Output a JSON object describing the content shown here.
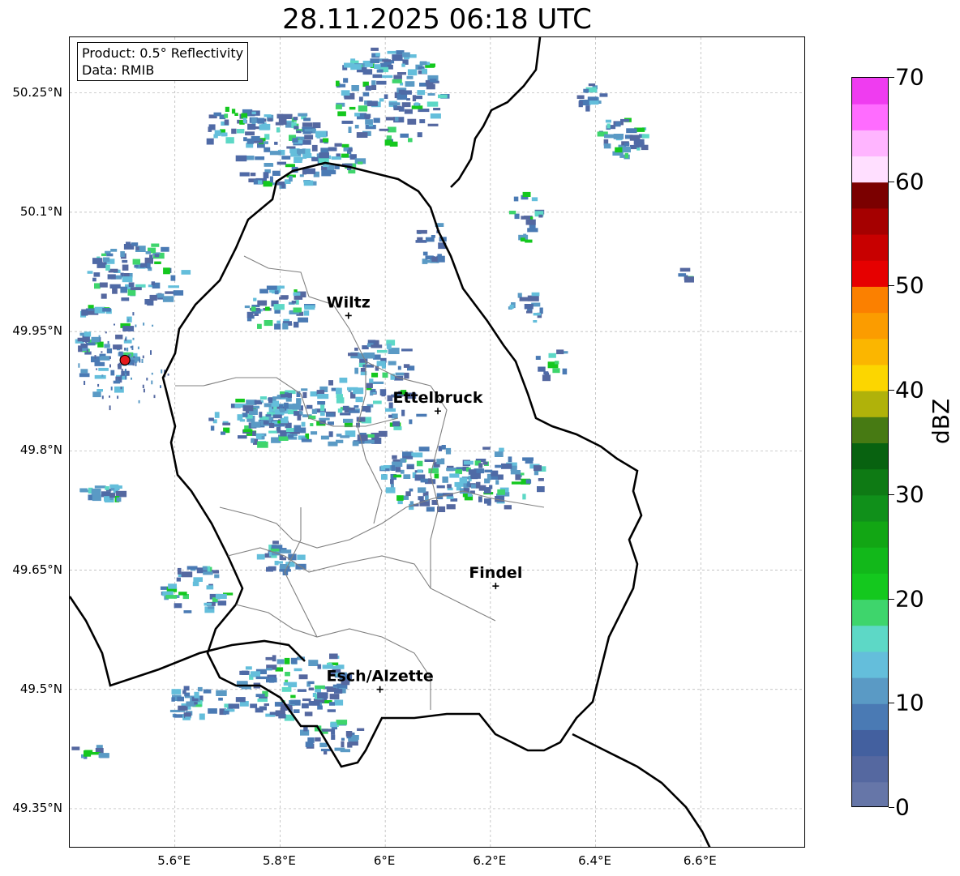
{
  "title": "28.11.2025 06:18 UTC",
  "info_box": {
    "product": "Product: 0.5° Reflectivity",
    "data": "Data: RMIB"
  },
  "map_extent": {
    "lon": [
      5.4,
      6.8
    ],
    "lat": [
      49.3,
      50.32
    ]
  },
  "lat_ticks": [
    {
      "label": "50.25°N",
      "value": 50.25
    },
    {
      "label": "50.1°N",
      "value": 50.1
    },
    {
      "label": "49.95°N",
      "value": 49.95
    },
    {
      "label": "49.8°N",
      "value": 49.8
    },
    {
      "label": "49.65°N",
      "value": 49.65
    },
    {
      "label": "49.5°N",
      "value": 49.5
    },
    {
      "label": "49.35°N",
      "value": 49.35
    }
  ],
  "lon_ticks": [
    {
      "label": "5.6°E",
      "value": 5.6
    },
    {
      "label": "5.8°E",
      "value": 5.8
    },
    {
      "label": "6°E",
      "value": 6.0
    },
    {
      "label": "6.2°E",
      "value": 6.2
    },
    {
      "label": "6.4°E",
      "value": 6.4
    },
    {
      "label": "6.6°E",
      "value": 6.6
    }
  ],
  "cities": [
    {
      "name": "Wiltz",
      "lon": 5.93,
      "lat": 49.97
    },
    {
      "name": "Ettelbruck",
      "lon": 6.1,
      "lat": 49.85
    },
    {
      "name": "Findel",
      "lon": 6.21,
      "lat": 49.63
    },
    {
      "name": "Esch/Alzette",
      "lon": 5.99,
      "lat": 49.5
    }
  ],
  "radar_site": {
    "lon": 5.505,
    "lat": 49.914,
    "color": "#e41a1c"
  },
  "colorbar": {
    "label": "dBZ",
    "min": 0,
    "max": 70,
    "ticks": [
      "0",
      "10",
      "20",
      "30",
      "40",
      "50",
      "60",
      "70"
    ],
    "colors": [
      "#6676a8",
      "#5568a0",
      "#43609f",
      "#4a7ab4",
      "#5a9ac5",
      "#64bedb",
      "#5dd8c6",
      "#3ed56c",
      "#14c81e",
      "#12b81a",
      "#12a614",
      "#10901a",
      "#0e7a14",
      "#086210",
      "#477a13",
      "#b0b20a",
      "#fcd600",
      "#fbb600",
      "#fb9c00",
      "#fb8000",
      "#e60000",
      "#c80000",
      "#a50000",
      "#7b0000",
      "#ffdfff",
      "#ffb5ff",
      "#ff6cff",
      "#ef3cf0"
    ]
  }
}
